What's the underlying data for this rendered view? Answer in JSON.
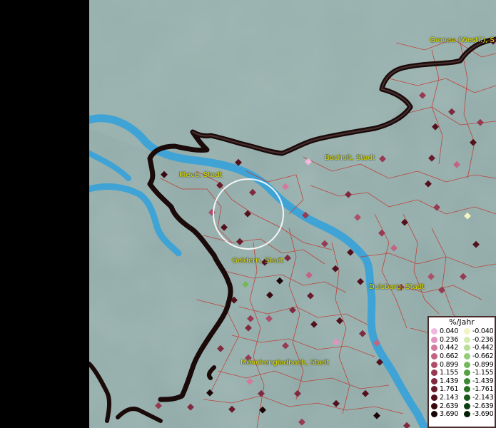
{
  "map": {
    "colors": {
      "background": "#8fa9a6",
      "river": "#3fa3d6",
      "border": "#1a0a0a",
      "district_line": "#c2372f",
      "label": "#e8e400"
    },
    "labels": [
      {
        "id": "gronau",
        "text": "Gronau (Westf.), S"
      },
      {
        "id": "bocholt",
        "text": "Bocholt, Stadt"
      },
      {
        "id": "kleve",
        "text": "Kleve, Stadt"
      },
      {
        "id": "geldern",
        "text": "Geldern, Stadt"
      },
      {
        "id": "duisburg",
        "text": "Duisburg, Stadt"
      },
      {
        "id": "moenchengladbach",
        "text": "Mönchengladbach, Stadt"
      }
    ],
    "selection_circle": {
      "present": true
    }
  },
  "legend": {
    "title": "%/Jahr",
    "positive": [
      {
        "label": "0.040",
        "color": "#f2b8e0"
      },
      {
        "label": "0.236",
        "color": "#e294bf"
      },
      {
        "label": "0.442",
        "color": "#d27a9e"
      },
      {
        "label": "0.662",
        "color": "#c26482"
      },
      {
        "label": "0.899",
        "color": "#ae4e69"
      },
      {
        "label": "1.155",
        "color": "#973a52"
      },
      {
        "label": "1.439",
        "color": "#7f2a3f"
      },
      {
        "label": "1.761",
        "color": "#691b2c"
      },
      {
        "label": "2.143",
        "color": "#52111d"
      },
      {
        "label": "2.639",
        "color": "#3a0810"
      },
      {
        "label": "3.690",
        "color": "#1a0306"
      }
    ],
    "negative": [
      {
        "label": "-0.040",
        "color": "#f2f5c2"
      },
      {
        "label": "-0.236",
        "color": "#d6ebb0"
      },
      {
        "label": "-0.442",
        "color": "#b8de96"
      },
      {
        "label": "-0.662",
        "color": "#96cc78"
      },
      {
        "label": "-0.899",
        "color": "#74b85c"
      },
      {
        "label": "-1.155",
        "color": "#55a143"
      },
      {
        "label": "-1.439",
        "color": "#3c8a31"
      },
      {
        "label": "-1.761",
        "color": "#287224"
      },
      {
        "label": "-2.143",
        "color": "#18591a"
      },
      {
        "label": "-2.639",
        "color": "#0c3f10"
      },
      {
        "label": "-3.690",
        "color": "#031f06"
      }
    ]
  }
}
